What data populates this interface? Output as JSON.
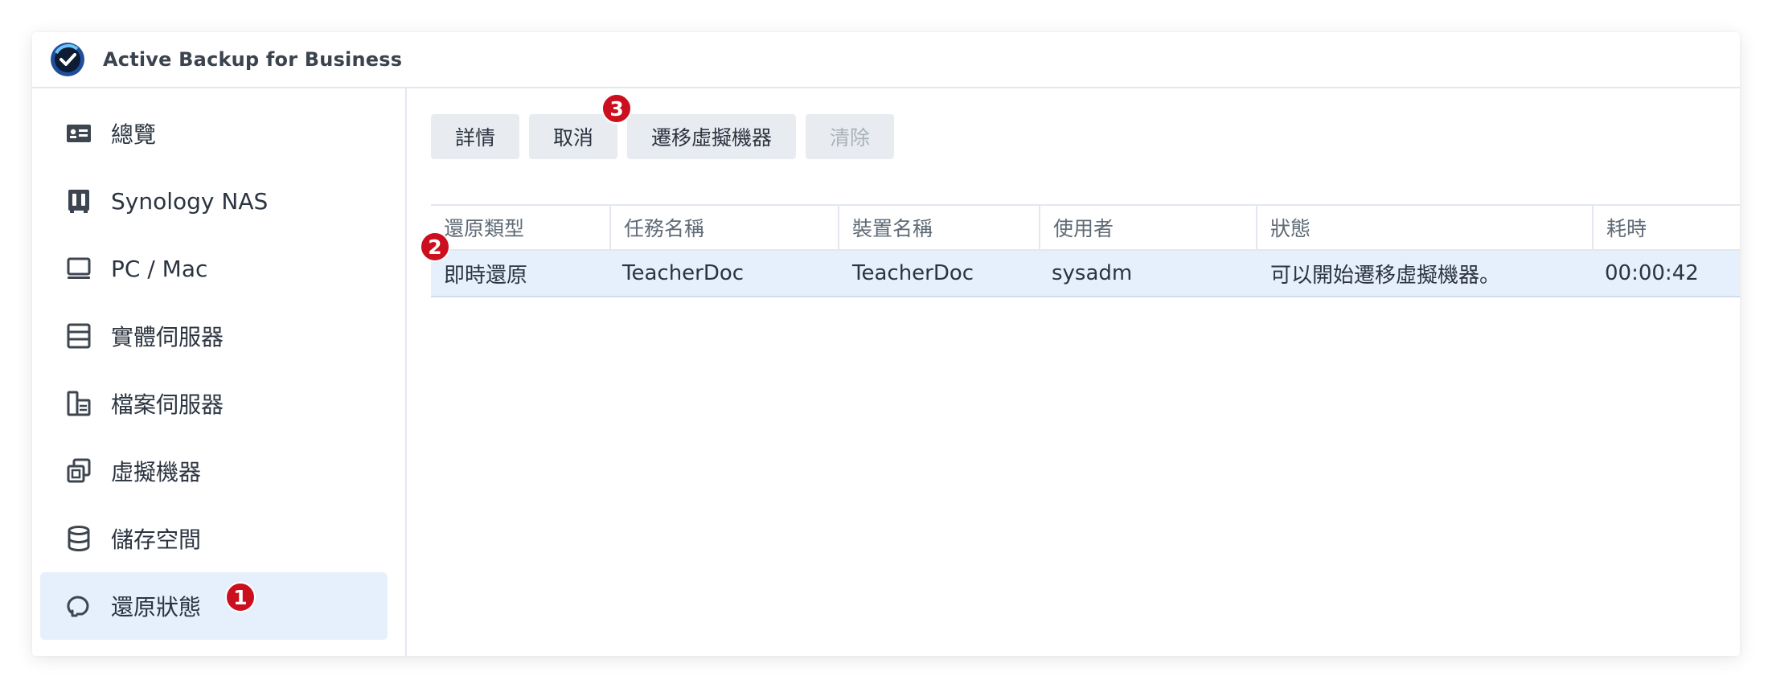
{
  "app": {
    "title": "Active Backup for Business",
    "logo_icon": "active-backup-logo-icon"
  },
  "sidebar": {
    "items": [
      {
        "label": "總覽",
        "icon": "overview-icon"
      },
      {
        "label": "Synology NAS",
        "icon": "nas-icon"
      },
      {
        "label": "PC / Mac",
        "icon": "monitor-icon"
      },
      {
        "label": "實體伺服器",
        "icon": "server-icon"
      },
      {
        "label": "檔案伺服器",
        "icon": "file-server-icon"
      },
      {
        "label": "虛擬機器",
        "icon": "virtual-machine-icon"
      },
      {
        "label": "儲存空間",
        "icon": "storage-icon"
      },
      {
        "label": "還原狀態",
        "icon": "restore-status-icon",
        "active": true
      }
    ]
  },
  "toolbar": {
    "details": "詳情",
    "cancel": "取消",
    "migrate_vm": "遷移虛擬機器",
    "clear": "清除"
  },
  "table": {
    "columns": [
      "還原類型",
      "任務名稱",
      "裝置名稱",
      "使用者",
      "狀態",
      "耗時"
    ],
    "rows": [
      [
        "即時還原",
        "TeacherDoc",
        "TeacherDoc",
        "sysadm",
        "可以開始遷移虛擬機器。",
        "00:00:42"
      ]
    ]
  },
  "annotations": {
    "badge1": "1",
    "badge2": "2",
    "badge3": "3"
  },
  "colors": {
    "accent": "#e6effc",
    "badge": "#cc0f1e",
    "text": "#2b3440"
  }
}
